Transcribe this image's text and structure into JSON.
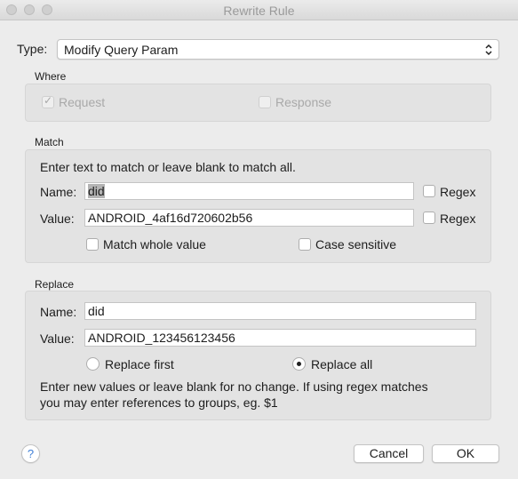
{
  "window": {
    "title": "Rewrite Rule"
  },
  "type": {
    "label": "Type:",
    "value": "Modify Query Param"
  },
  "where": {
    "label": "Where",
    "request": {
      "label": "Request",
      "checked": true,
      "enabled": false
    },
    "response": {
      "label": "Response",
      "checked": false,
      "enabled": false
    }
  },
  "match": {
    "label": "Match",
    "hint": "Enter text to match or leave blank to match all.",
    "name_label": "Name:",
    "name_value": "did",
    "value_label": "Value:",
    "value_value": "ANDROID_4af16d720602b56",
    "regex_label": "Regex",
    "regex2_label": "Regex",
    "whole_label": "Match whole value",
    "case_label": "Case sensitive"
  },
  "replace": {
    "label": "Replace",
    "name_label": "Name:",
    "name_value": "did",
    "value_label": "Value:",
    "value_value": "ANDROID_123456123456",
    "first_label": "Replace first",
    "all_label": "Replace all",
    "selected": "all",
    "hint_line1": "Enter new values or leave blank for no change. If using regex matches",
    "hint_line2": "you may enter references to groups, eg. $1"
  },
  "buttons": {
    "help": "?",
    "cancel": "Cancel",
    "ok": "OK"
  }
}
